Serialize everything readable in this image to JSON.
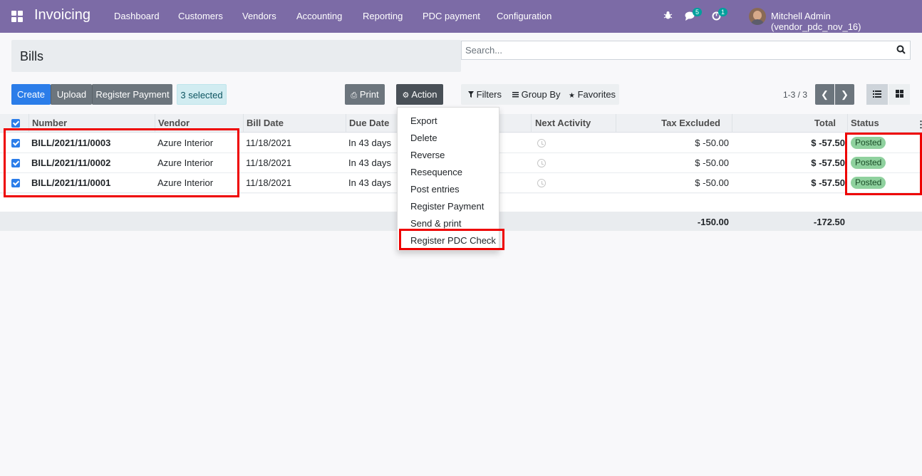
{
  "navbar": {
    "app_title": "Invoicing",
    "menu": [
      "Dashboard",
      "Customers",
      "Vendors",
      "Accounting",
      "Reporting",
      "PDC payment",
      "Configuration"
    ],
    "messages_count": "5",
    "activities_count": "1",
    "user_name": "Mitchell Admin (vendor_pdc_nov_16)",
    "accent_color": "#7c6ba6"
  },
  "control_panel": {
    "breadcrumb": "Bills",
    "search_placeholder": "Search...",
    "buttons": {
      "create": "Create",
      "upload": "Upload",
      "register_payment": "Register Payment",
      "selected": "3 selected",
      "print": "Print",
      "action": "Action"
    },
    "filters": {
      "filters": "Filters",
      "group_by": "Group By",
      "favorites": "Favorites"
    },
    "pager": "1-3 / 3"
  },
  "table": {
    "headers": {
      "number": "Number",
      "vendor": "Vendor",
      "bill_date": "Bill Date",
      "due_date": "Due Date",
      "next_activity": "Next Activity",
      "tax_excluded": "Tax Excluded",
      "total": "Total",
      "status": "Status"
    },
    "rows": [
      {
        "number": "BILL/2021/11/0003",
        "vendor": "Azure Interior",
        "bill_date": "11/18/2021",
        "due_date": "In 43 days",
        "tax_excluded": "$ -50.00",
        "total": "$ -57.50",
        "status": "Posted"
      },
      {
        "number": "BILL/2021/11/0002",
        "vendor": "Azure Interior",
        "bill_date": "11/18/2021",
        "due_date": "In 43 days",
        "tax_excluded": "$ -50.00",
        "total": "$ -57.50",
        "status": "Posted"
      },
      {
        "number": "BILL/2021/11/0001",
        "vendor": "Azure Interior",
        "bill_date": "11/18/2021",
        "due_date": "In 43 days",
        "tax_excluded": "$ -50.00",
        "total": "$ -57.50",
        "status": "Posted"
      }
    ],
    "footer": {
      "tax_excluded": "-150.00",
      "total": "-172.50"
    }
  },
  "action_menu": {
    "items": [
      "Export",
      "Delete",
      "Reverse",
      "Resequence",
      "Post entries",
      "Register Payment",
      "Send & print",
      "Register PDC Check"
    ]
  },
  "colors": {
    "primary": "#2b7de9",
    "posted_badge": "#8fd19e",
    "highlight": "#ee0000"
  }
}
